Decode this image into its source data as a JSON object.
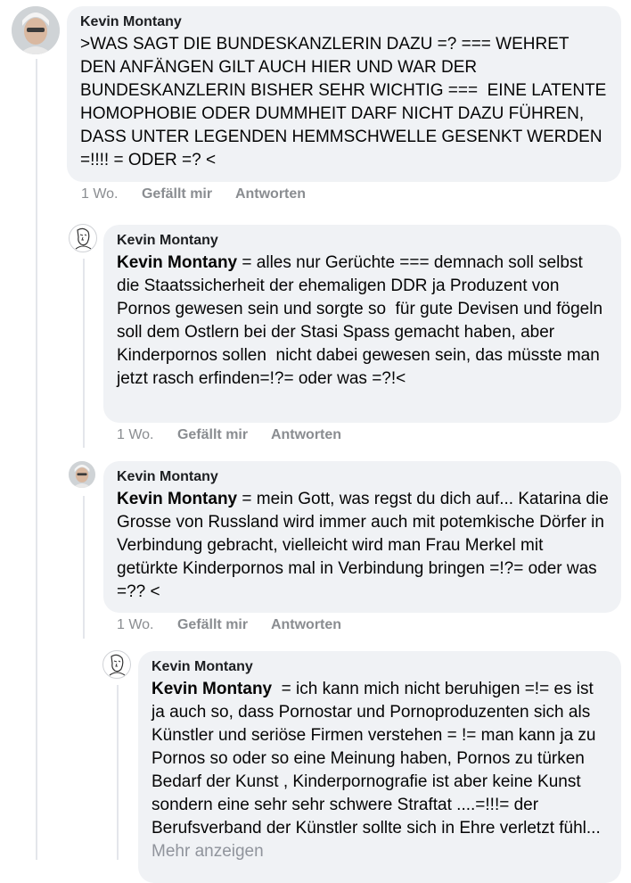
{
  "comments": [
    {
      "author": "Kevin Montany",
      "inline_author": "",
      "text": ">WAS SAGT DIE BUNDESKANZLERIN DAZU =? === WEHRET DEN ANFÄNGEN GILT AUCH HIER UND WAR DER BUNDESKANZLERIN BISHER SEHR WICHTIG ===  EINE LATENTE HOMOPHOBIE ODER DUMMHEIT DARF NICHT DAZU FÜHREN, DASS UNTER LEGENDEN HEMMSCHWELLE GESENKT WERDEN =!!!! = ODER =? <",
      "time": "1 Wo.",
      "like": "Gefällt mir",
      "reply": "Antworten"
    },
    {
      "author": "Kevin Montany",
      "inline_author": "Kevin Montany",
      "text": " = alles nur Gerüchte === demnach soll selbst die Staatssicherheit der ehemaligen DDR ja Produzent von Pornos gewesen sein und sorgte so  für gute Devisen und fögeln soll dem Ostlern bei der Stasi Spass gemacht haben, aber Kinderpornos sollen  nicht dabei gewesen sein, das müsste man jetzt rasch erfinden=!?= oder was =?!<",
      "time": "1 Wo.",
      "like": "Gefällt mir",
      "reply": "Antworten"
    },
    {
      "author": "Kevin Montany",
      "inline_author": "Kevin Montany",
      "text": " = mein Gott, was regst du dich auf... Katarina die Grosse von Russland wird immer auch mit potemkische Dörfer in Verbindung gebracht, vielleicht wird man Frau Merkel mit getürkte Kinderpornos mal in Verbindung bringen =!?= oder was =?? <",
      "time": "1 Wo.",
      "like": "Gefällt mir",
      "reply": "Antworten"
    },
    {
      "author": "Kevin Montany",
      "inline_author": "Kevin Montany",
      "text": "  = ich kann mich nicht beruhigen =!= es ist ja auch so, dass Pornostar und Pornoproduzenten sich als Künstler und seriöse Firmen verstehen = != man kann ja zu Pornos so oder so eine Meinung haben, Pornos zu türken Bedarf der Kunst , Kinderpornografie ist aber keine Kunst sondern eine sehr sehr schwere Straftat ....=!!!= der Berufsverband der Künstler sollte sich in Ehre verletzt fühl...",
      "more": " Mehr anzeigen"
    }
  ],
  "icons": [
    "avatar-photo",
    "avatar-sketch"
  ]
}
